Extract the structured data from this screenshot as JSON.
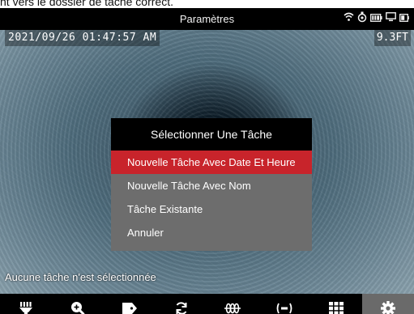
{
  "caption": "nt vers le dossier de tâche correct.",
  "header": {
    "title": "Paramètres",
    "status_icons": [
      "wifi-icon",
      "gps-icon",
      "battery-icon",
      "monitor-icon",
      "device-battery-icon"
    ]
  },
  "overlay": {
    "timestamp": "2021/09/26 01:47:57 AM",
    "distance": "9.3FT",
    "task_status": "Aucune tâche n'est sélectionnée"
  },
  "dialog": {
    "title": "Sélectionner Une Tâche",
    "options": [
      "Nouvelle Tâche Avec Date Et Heure",
      "Nouvelle Tâche Avec Nom",
      "Tâche Existante",
      "Annuler"
    ],
    "selected_index": 0,
    "selected_color": "#c8242b"
  },
  "toolbar": {
    "buttons": [
      "light-icon",
      "zoom-icon",
      "tag-icon",
      "rotate-icon",
      "coil-icon",
      "sonde-icon",
      "grid-icon",
      "gear-icon"
    ],
    "active": "gear-icon",
    "active_color": "#6a6a6a"
  }
}
